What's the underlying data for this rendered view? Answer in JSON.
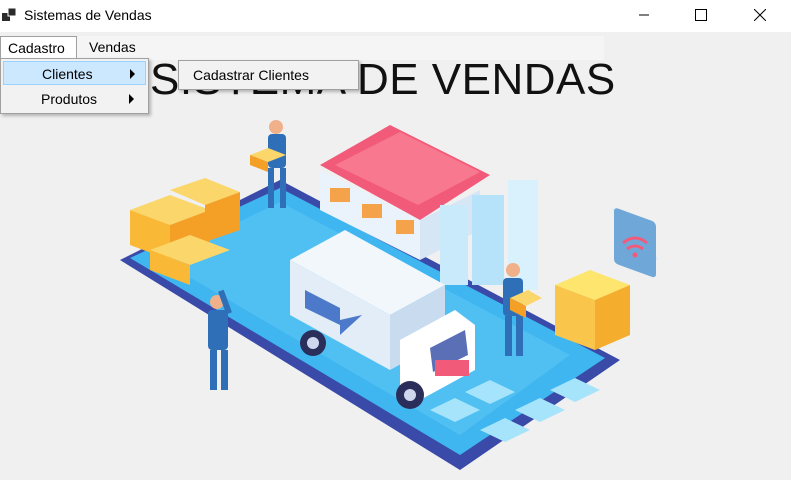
{
  "window": {
    "title": "Sistemas de Vendas",
    "controls": [
      "minimize",
      "maximize",
      "close"
    ]
  },
  "menu": {
    "cadastro": "Cadastro",
    "vendas": "Vendas",
    "dropdown": {
      "clientes": "Clientes",
      "produtos": "Produtos"
    },
    "submenu": {
      "cadastrar_clientes": "Cadastrar Clientes"
    }
  },
  "main": {
    "heading": "SISTEMA DE VENDAS"
  },
  "colors": {
    "menu_highlight": "#cce8ff",
    "client_bg": "#f0f0f0",
    "roof": "#f25a7a",
    "phone_screen": "#3fb6ef",
    "boxes": "#f9c54a"
  }
}
